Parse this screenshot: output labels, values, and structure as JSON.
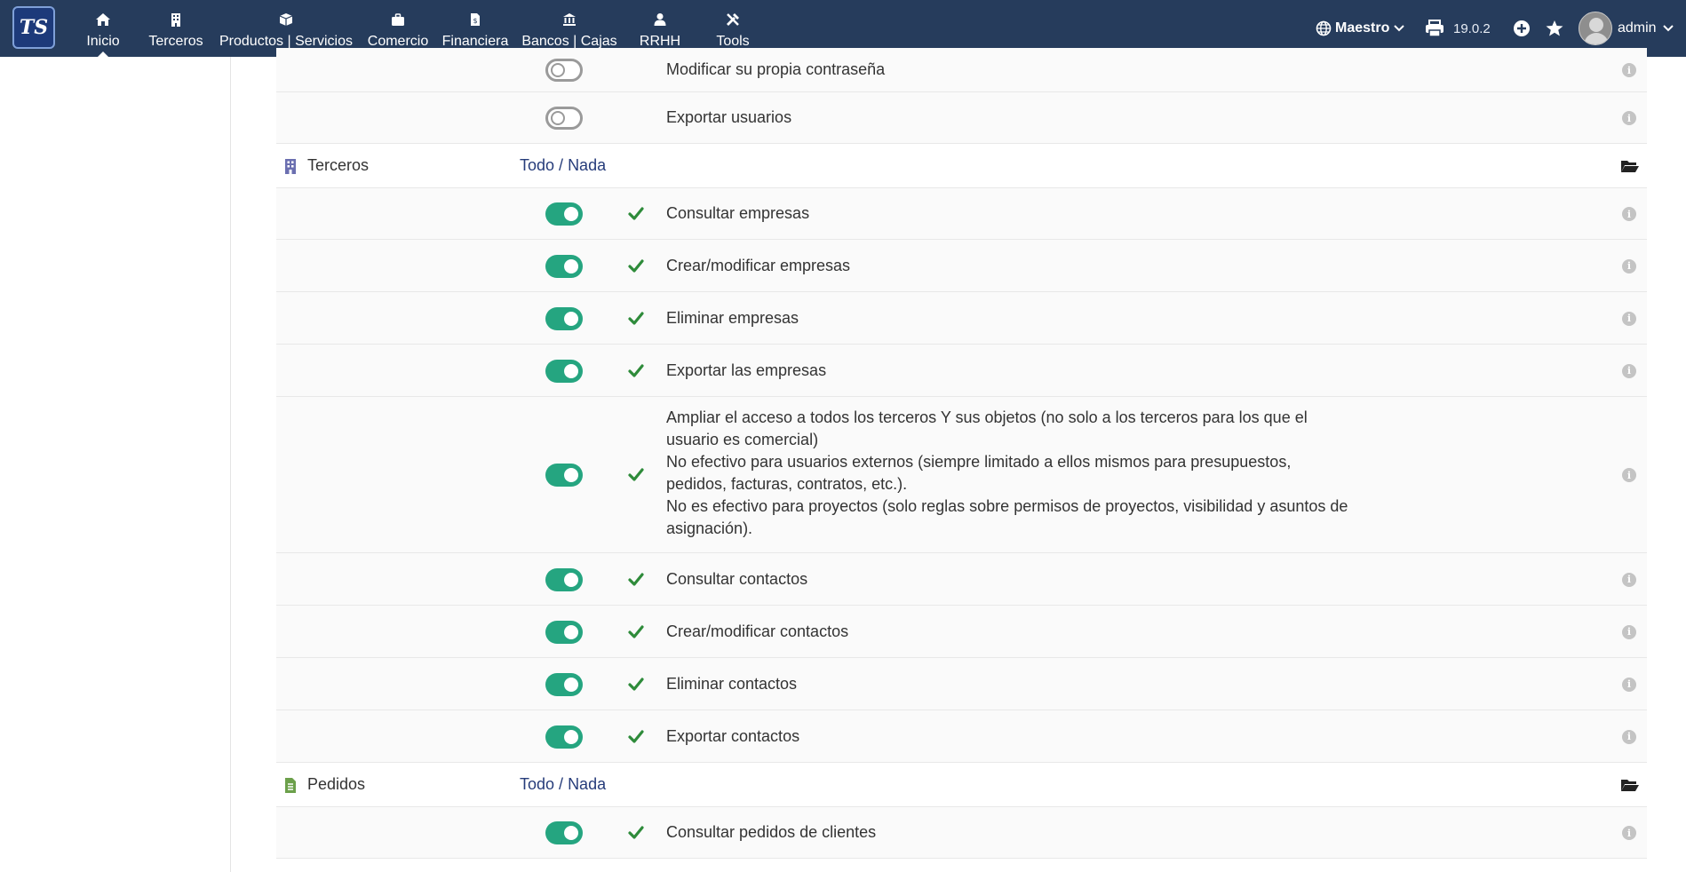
{
  "app": {
    "logo_text": "TS"
  },
  "nav": [
    {
      "label": "Inicio",
      "icon": "home-icon"
    },
    {
      "label": "Terceros",
      "icon": "building-icon"
    },
    {
      "label": "Productos | Servicios",
      "icon": "box-icon"
    },
    {
      "label": "Comercio",
      "icon": "briefcase-icon"
    },
    {
      "label": "Financiera",
      "icon": "invoice-icon"
    },
    {
      "label": "Bancos | Cajas",
      "icon": "bank-icon"
    },
    {
      "label": "RRHH",
      "icon": "user-icon"
    },
    {
      "label": "Tools",
      "icon": "tools-icon"
    }
  ],
  "toolbar": {
    "entity": "Maestro",
    "version": "19.0.2",
    "user": "admin"
  },
  "colors": {
    "topbar": "#263c5c",
    "toggle_on": "#25a580",
    "check": "#2e8b3a",
    "link": "#263c7a"
  },
  "rows": [
    {
      "type": "perm",
      "enabled": false,
      "checked": false,
      "text": "Modificar su propia contraseña"
    },
    {
      "type": "perm",
      "enabled": false,
      "checked": false,
      "text": "Exportar usuarios"
    },
    {
      "type": "group",
      "name": "Terceros",
      "icon": "building-icon",
      "all": "Todo",
      "sep": " / ",
      "none": "Nada"
    },
    {
      "type": "perm",
      "enabled": true,
      "checked": true,
      "text": "Consultar empresas"
    },
    {
      "type": "perm",
      "enabled": true,
      "checked": true,
      "text": "Crear/modificar empresas"
    },
    {
      "type": "perm",
      "enabled": true,
      "checked": true,
      "text": "Eliminar empresas"
    },
    {
      "type": "perm",
      "enabled": true,
      "checked": true,
      "text": "Exportar las empresas"
    },
    {
      "type": "perm",
      "enabled": true,
      "checked": true,
      "lines": [
        "Ampliar el acceso a todos los terceros Y sus objetos (no solo a los terceros para los que el",
        "usuario es comercial)",
        "No efectivo para usuarios externos (siempre limitado a ellos mismos para presupuestos,",
        "pedidos, facturas, contratos, etc.).",
        "No es efectivo para proyectos (solo reglas sobre permisos de proyectos, visibilidad y asuntos de",
        "asignación)."
      ]
    },
    {
      "type": "perm",
      "enabled": true,
      "checked": true,
      "text": "Consultar contactos"
    },
    {
      "type": "perm",
      "enabled": true,
      "checked": true,
      "text": "Crear/modificar contactos"
    },
    {
      "type": "perm",
      "enabled": true,
      "checked": true,
      "text": "Eliminar contactos"
    },
    {
      "type": "perm",
      "enabled": true,
      "checked": true,
      "text": "Exportar contactos"
    },
    {
      "type": "group",
      "name": "Pedidos",
      "icon": "document-icon",
      "all": "Todo",
      "sep": " / ",
      "none": "Nada"
    },
    {
      "type": "perm",
      "enabled": true,
      "checked": true,
      "text": "Consultar pedidos de clientes"
    }
  ]
}
